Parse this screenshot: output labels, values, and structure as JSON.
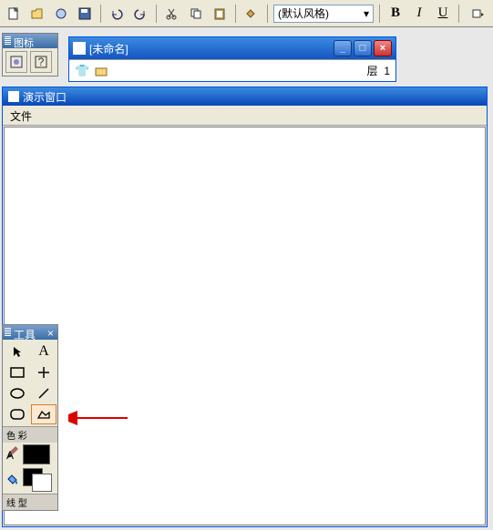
{
  "toolbar": {
    "style_select": "(默认风格)",
    "bold": "B",
    "italic": "I",
    "underline": "U"
  },
  "icon_panel": {
    "title": "图标"
  },
  "doc_window": {
    "title": "[未命名]",
    "layer_label": "层",
    "layer_value": "1"
  },
  "display_window": {
    "title": "演示窗口",
    "menu_file": "文件"
  },
  "tools_panel": {
    "title": "工具",
    "close": "×",
    "section_color": "色 彩",
    "section_line": "线 型"
  }
}
